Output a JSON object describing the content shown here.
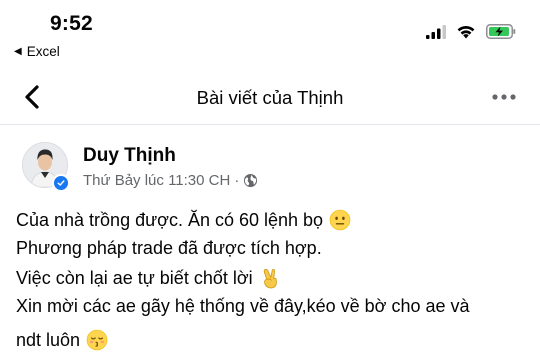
{
  "status_bar": {
    "time": "9:52",
    "back_app": "Excel",
    "back_app_icon": "back-triangle-icon",
    "icons": [
      "cellular-signal-icon",
      "wifi-icon",
      "battery-charging-icon"
    ]
  },
  "nav": {
    "title": "Bài viết của Thịnh",
    "back_icon": "chevron-left-icon",
    "more_icon": "more-horizontal-icon"
  },
  "post": {
    "author": "Duy Thịnh",
    "timestamp": "Thứ Bảy lúc 11:30 CH",
    "separator": "·",
    "audience_icon": "globe-icon",
    "lines": [
      "Của nhà trồng được. Ăn có 60 lệnh bọ",
      "Phương pháp trade đã được tích hợp.",
      "Việc còn lại ae tự biết chốt lời",
      "Xin mời các ae gãy hệ thống về đây,kéo về bờ cho ae và",
      "ndt luôn"
    ],
    "emojis": [
      "neutral-face-emoji",
      "victory-hand-emoji",
      "kissing-face-emoji"
    ]
  },
  "colors": {
    "verified": "#1877f2",
    "battery": "#34c759",
    "secondary_text": "#65676b"
  }
}
